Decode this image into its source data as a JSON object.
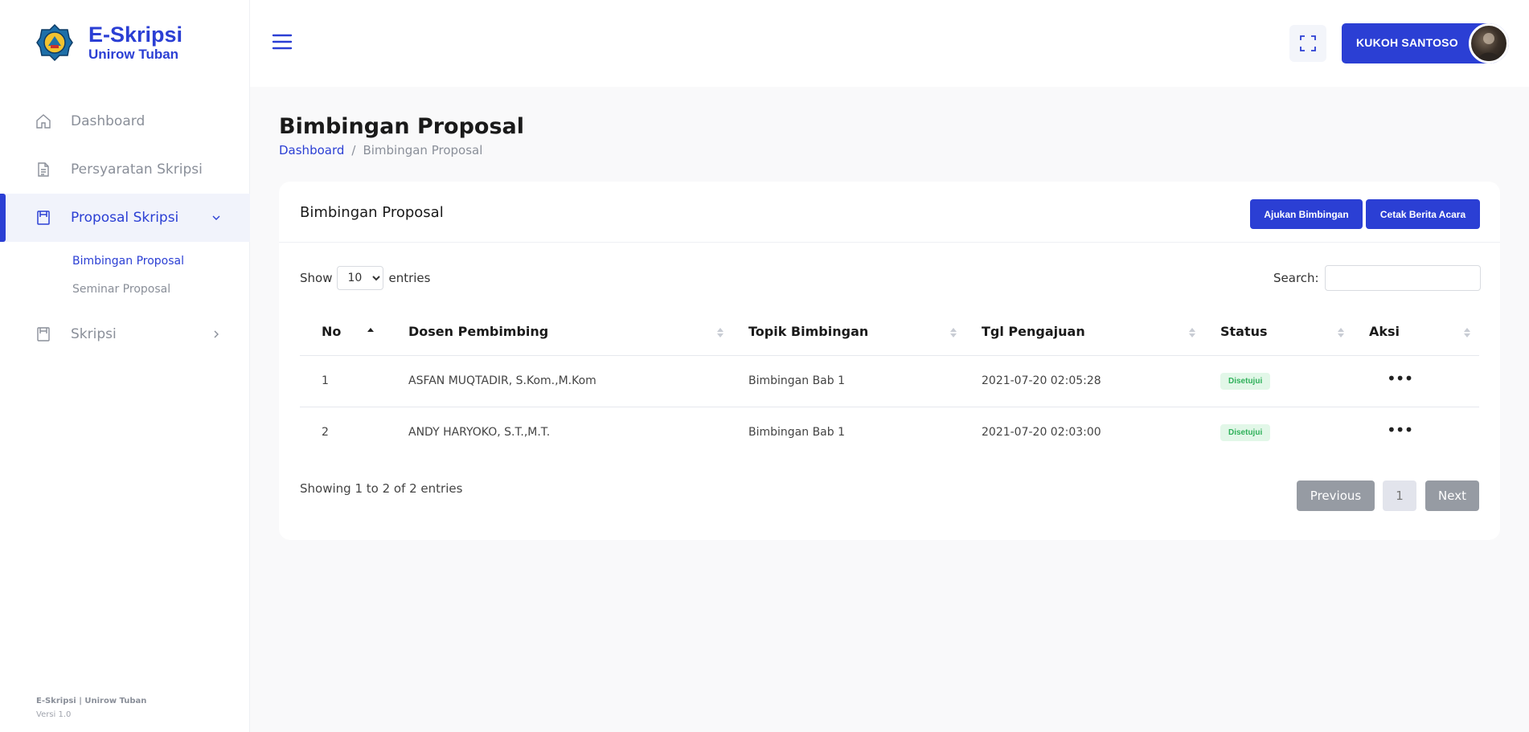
{
  "brand": {
    "title": "E-Skripsi",
    "subtitle": "Unirow Tuban"
  },
  "sidebar": {
    "items": [
      {
        "label": "Dashboard",
        "icon": "home-icon"
      },
      {
        "label": "Persyaratan Skripsi",
        "icon": "document-icon"
      },
      {
        "label": "Proposal Skripsi",
        "icon": "book-icon",
        "active": true,
        "expanded": true
      },
      {
        "label": "Skripsi",
        "icon": "book-icon"
      }
    ],
    "subitems": [
      {
        "label": "Bimbingan Proposal",
        "active": true
      },
      {
        "label": "Seminar Proposal"
      }
    ],
    "footer": {
      "line1": "E-Skripsi | Unirow Tuban",
      "line2": "Versi 1.0"
    }
  },
  "topbar": {
    "user_name": "KUKOH SANTOSO"
  },
  "page": {
    "title": "Bimbingan Proposal",
    "breadcrumb": {
      "home": "Dashboard",
      "separator": "/",
      "current": "Bimbingan Proposal"
    }
  },
  "card": {
    "title": "Bimbingan Proposal",
    "btn_ajukan": "Ajukan Bimbingan",
    "btn_cetak": "Cetak Berita Acara",
    "show_label": "Show",
    "entries_label": "entries",
    "page_length": "10",
    "search_label": "Search:",
    "search_value": ""
  },
  "table": {
    "columns": [
      "No",
      "Dosen Pembimbing",
      "Topik Bimbingan",
      "Tgl Pengajuan",
      "Status",
      "Aksi"
    ],
    "rows": [
      {
        "no": "1",
        "dosen": "ASFAN MUQTADIR, S.Kom.,M.Kom",
        "topik": "Bimbingan Bab 1",
        "tgl": "2021-07-20 02:05:28",
        "status": "Disetujui"
      },
      {
        "no": "2",
        "dosen": "ANDY HARYOKO, S.T.,M.T.",
        "topik": "Bimbingan Bab 1",
        "tgl": "2021-07-20 02:03:00",
        "status": "Disetujui"
      }
    ],
    "info": "Showing 1 to 2 of 2 entries",
    "pagination": {
      "previous": "Previous",
      "current_page": "1",
      "next": "Next"
    }
  },
  "colors": {
    "primary": "#2b3fd4",
    "success_bg": "#e2f7e8",
    "success_text": "#2fb15a"
  }
}
